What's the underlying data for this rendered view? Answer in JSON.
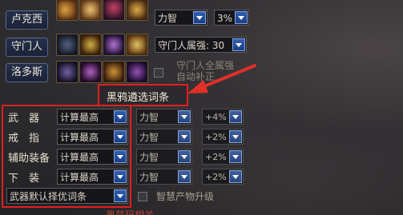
{
  "heroes": [
    {
      "name": "卢克西"
    },
    {
      "name": "守门人"
    },
    {
      "name": "洛多斯"
    }
  ],
  "top_partial": {
    "stat_value": "力智",
    "pct_value": "3%"
  },
  "gatekeeper": {
    "attr_select": "守门人属强: 30",
    "fullattr_label_1": "守门人全属强",
    "fullattr_label_2": "自动补正"
  },
  "callout": {
    "text": "黑鸦遴选词条"
  },
  "rows": [
    {
      "label": "武　器",
      "mode": "计算最高",
      "stat": "力智",
      "pct": "+4%"
    },
    {
      "label": "戒　指",
      "mode": "计算最高",
      "stat": "力智",
      "pct": "+2%"
    },
    {
      "label": "辅助装备",
      "mode": "计算最高",
      "stat": "力智",
      "pct": "+2%"
    },
    {
      "label": "下　装",
      "mode": "计算最高",
      "stat": "力智",
      "pct": "+2%"
    }
  ],
  "default_select": "武器默认择优词条",
  "wisdom_label": "智慧产物升级",
  "bottom_partial": "奥兹玛相关",
  "colors": {
    "highlight": "#e02020",
    "arrow": "#e03028",
    "dropdown_arrow": "#2f5fb4"
  }
}
